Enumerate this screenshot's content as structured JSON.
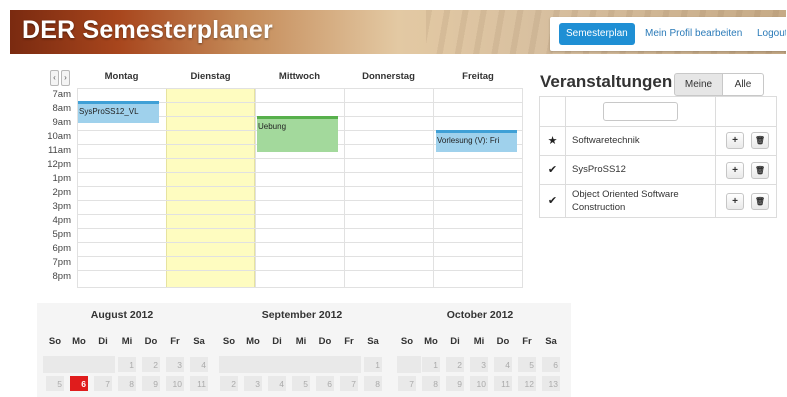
{
  "header": {
    "title": "DER Semesterplaner",
    "nav": [
      "Semesterplan",
      "Mein Profil bearbeiten",
      "Logout"
    ]
  },
  "week": {
    "days": [
      "Montag",
      "Dienstag",
      "Mittwoch",
      "Donnerstag",
      "Freitag"
    ],
    "times": [
      "7am",
      "8am",
      "9am",
      "10am",
      "11am",
      "12pm",
      "1pm",
      "2pm",
      "3pm",
      "4pm",
      "5pm",
      "6pm",
      "7pm",
      "8pm"
    ],
    "events": [
      "SysProSS12_VL",
      "Uebung",
      "Vorlesung (V): Fri"
    ],
    "colors": {
      "today": "#fefcc0",
      "blue_event": "#9fd1ec",
      "green_event": "#a3d99c"
    }
  },
  "sidebar": {
    "title": "Veranstaltungen",
    "tabs": [
      "Meine",
      "Alle"
    ],
    "filter_value": "",
    "rows": [
      {
        "icon": "star-icon",
        "name": "Softwaretechnik"
      },
      {
        "icon": "check-icon",
        "name": "SysProSS12"
      },
      {
        "icon": "check-icon",
        "name": "Object Oriented Software Construction"
      }
    ]
  },
  "months": [
    {
      "title": "August 2012",
      "days": [
        "1",
        "2",
        "3",
        "4",
        "5",
        "6",
        "7",
        "8",
        "9",
        "10",
        "11"
      ]
    },
    {
      "title": "September 2012",
      "days": [
        "1",
        "2",
        "3",
        "4",
        "5",
        "6",
        "7",
        "8"
      ]
    },
    {
      "title": "October 2012",
      "days": [
        "1",
        "2",
        "3",
        "4",
        "5",
        "6",
        "7",
        "8",
        "9",
        "10",
        "11",
        "12",
        "13"
      ]
    }
  ],
  "weekday_short": [
    "So",
    "Mo",
    "Di",
    "Mi",
    "Do",
    "Fr",
    "Sa"
  ],
  "selected_date": "6"
}
